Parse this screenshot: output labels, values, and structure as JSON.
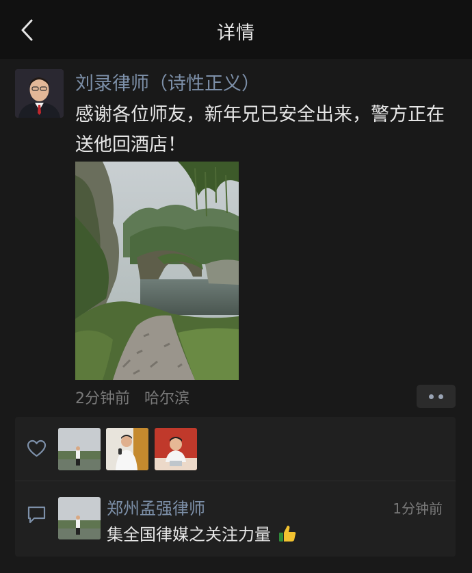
{
  "nav": {
    "title": "详情",
    "back_icon": "chevron-left-icon"
  },
  "post": {
    "author": "刘录律师（诗性正义）",
    "text": "感谢各位师友，新年兄已安全出来，警方正在送他回酒店！",
    "time": "2分钟前",
    "location": "哈尔滨",
    "more_icon": "more-dots-icon"
  },
  "likes": {
    "icon": "heart-icon",
    "avatars": [
      "like-avatar-1",
      "like-avatar-2",
      "like-avatar-3"
    ]
  },
  "comments": [
    {
      "author": "郑州孟强律师",
      "time": "1分钟前",
      "text": "集全国律媒之关注力量",
      "emoji": "thumbs-up-icon"
    }
  ],
  "colors": {
    "background": "#191919",
    "nav_background": "#111111",
    "name_link": "#7d90a9",
    "meta_gray": "#7a7a7a",
    "panel": "#202020"
  }
}
